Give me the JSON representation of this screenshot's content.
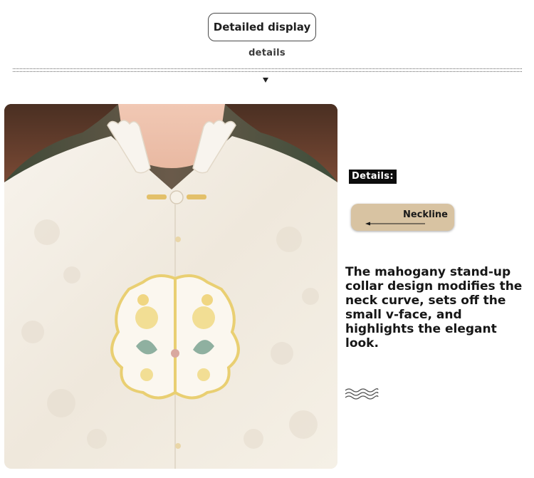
{
  "header": {
    "title": "Detailed display",
    "subtitle": "details"
  },
  "panel": {
    "details_tag": "Details:",
    "neckline_label": "Neckline",
    "description": "The mahogany stand-up collar design modifies the neck curve, sets off the small v-face, and highlights the elegant look."
  },
  "icons": {
    "down_arrow": "triangle-down-icon",
    "pointer_arrow": "arrow-left-icon",
    "wave": "wave-lines-icon"
  },
  "colors": {
    "pill_tan": "#d8c3a2",
    "tag_black": "#0d0d0d",
    "fabric_cream": "#f4f0e8",
    "embroidery_gold": "#e9cf72",
    "embroidery_green": "#8fb0a0"
  }
}
